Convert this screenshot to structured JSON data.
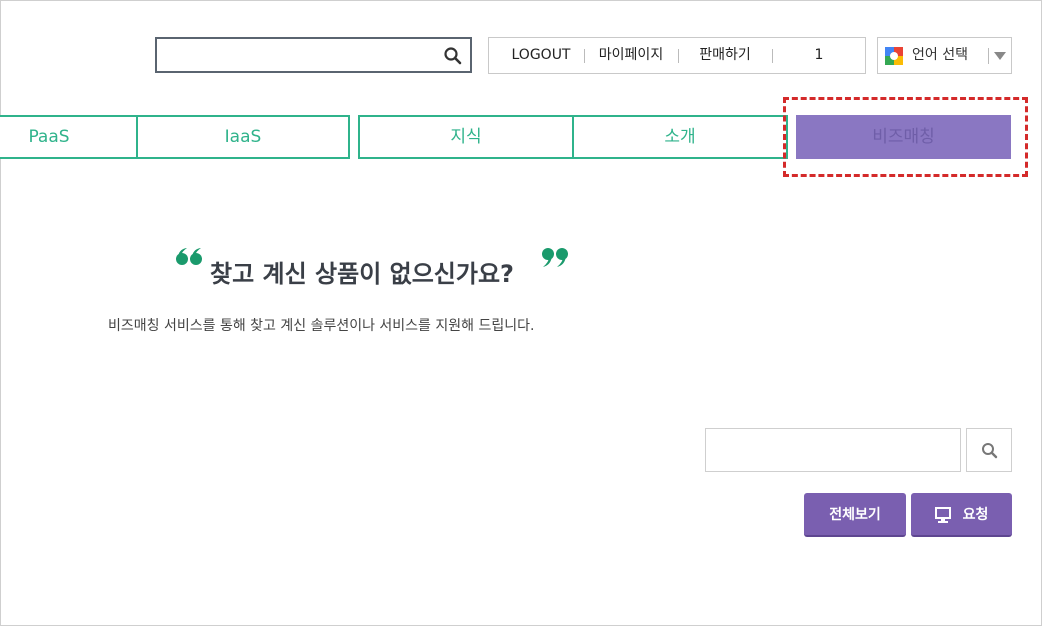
{
  "header": {
    "search_placeholder": "",
    "user_menu": {
      "logout": "LOGOUT",
      "mypage": "마이페이지",
      "sell": "판매하기",
      "count": "1"
    },
    "language_select": {
      "label": "언어 선택",
      "icon": "google-translate-icon"
    }
  },
  "nav": {
    "tabs": [
      {
        "label": "PaaS"
      },
      {
        "label": "IaaS"
      },
      {
        "label": "지식"
      },
      {
        "label": "소개"
      },
      {
        "label": "비즈매칭"
      }
    ],
    "active_color": "#8a77c2",
    "tab_color": "#2fb38b",
    "highlight_color": "#d42a2a"
  },
  "main": {
    "headline": "찾고 계신 상품이 없으신가요?",
    "subtext": "비즈매칭 서비스를 통해 찾고 계신 솔루션이나 서비스를 지원해 드립니다.",
    "search_placeholder": "",
    "view_all_label": "전체보기",
    "request_label": "요청"
  }
}
